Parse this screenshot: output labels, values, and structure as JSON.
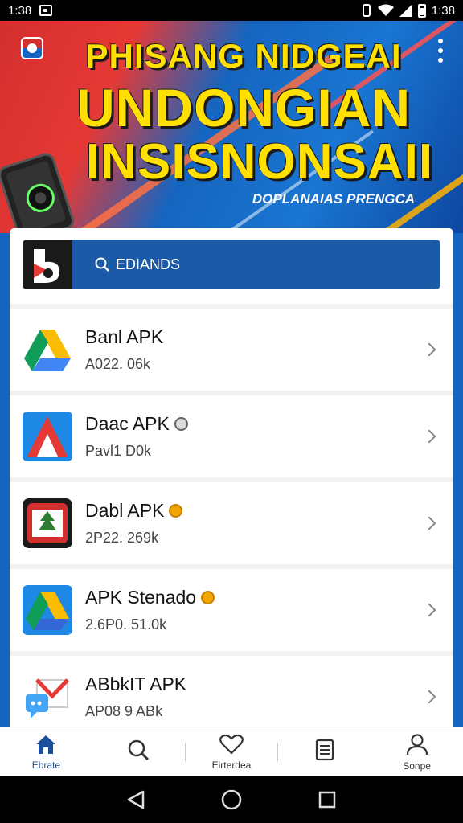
{
  "status_bar": {
    "time_left": "1:38",
    "time_right": "1:38"
  },
  "banner": {
    "line1": "PHISANG NIDGEAI",
    "line2": "UNDONGIAN",
    "line3": "INSISNONSAII",
    "subtitle": "DOPLANAIAS PRENGCA"
  },
  "search": {
    "placeholder": "EDIANDS"
  },
  "apps": [
    {
      "title": "Banl APK",
      "subtitle": "A022. 06k",
      "badge": ""
    },
    {
      "title": "Daac APK",
      "subtitle": "Pavl1 D0k",
      "badge": "grey"
    },
    {
      "title": "Dabl APK",
      "subtitle": "2P22. 269k",
      "badge": "gold"
    },
    {
      "title": "APK Stenado",
      "subtitle": "2.6P0. 51.0k",
      "badge": "gold"
    },
    {
      "title": "ABbkIT APK",
      "subtitle": "AP08 9 ABk",
      "badge": ""
    }
  ],
  "tabs": [
    {
      "label": "Ebrate",
      "icon": "home-icon"
    },
    {
      "label": "",
      "icon": "search-icon"
    },
    {
      "label": "Eirterdea",
      "icon": "heart-icon"
    },
    {
      "label": "",
      "icon": "document-icon"
    },
    {
      "label": "Sonpe",
      "icon": "profile-icon"
    }
  ],
  "colors": {
    "accent": "#1b4f9c",
    "banner_red": "#d32f2f",
    "banner_blue": "#1565c0",
    "title_yellow": "#ffe000"
  }
}
